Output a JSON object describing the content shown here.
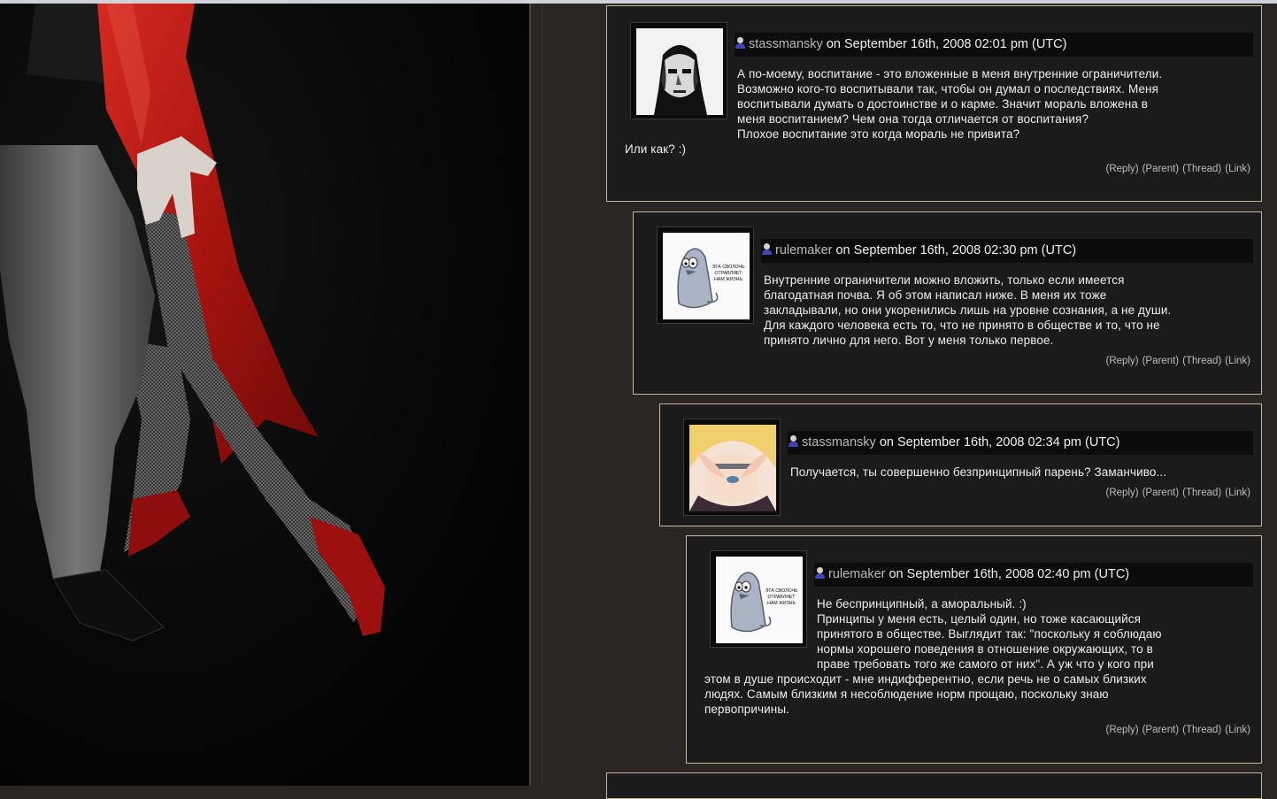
{
  "comments": [
    {
      "username": "stassmansky",
      "meta": " on September 16th, 2008 02:01 pm (UTC)",
      "avatar": "house-portrait",
      "lines_beside": [
        "А по-моему, воспитание - это вложенные в меня внутренние ограничители.",
        "Возможно кого-то воспитывали так, чтобы он думал о последствиях. Меня",
        "воспитывали думать о достоинстве и о карме. Значит мораль вложена в",
        "меня воспитанием? Чем она тогда отличается от воспитания?",
        "Плохое воспитание это когда мораль не привита?"
      ],
      "lines_below": [
        "Или как? :)"
      ],
      "links": [
        "(Reply)",
        "(Parent)",
        "(Thread)",
        "(Link)"
      ]
    },
    {
      "username": "rulemaker",
      "meta": " on September 16th, 2008 02:30 pm (UTC)",
      "avatar": "penguin-cartoon",
      "avatar_caption": [
        "ЭТА СВОЛОЧЬ",
        "ОТРАВЛЯЕТ",
        "НАМ ЖИЗНЬ"
      ],
      "lines_beside": [
        "Внутренние ограничители можно вложить, только если имеется",
        "благодатная почва. Я об этом написал ниже. В меня их тоже",
        "закладывали, но они укоренились лишь на уровне сознания, а не души.",
        "Для каждого человека есть то, что не принято в обществе и то, что не",
        "принято лично для него. Вот у меня только первое."
      ],
      "lines_below": [],
      "links": [
        "(Reply)",
        "(Parent)",
        "(Thread)",
        "(Link)"
      ]
    },
    {
      "username": "stassmansky",
      "meta": " on September 16th, 2008 02:34 pm (UTC)",
      "avatar": "anime-heart-hands",
      "lines_beside": [
        "Получается, ты совершенно безпринципный парень? Заманчиво..."
      ],
      "lines_below": [],
      "links": [
        "(Reply)",
        "(Parent)",
        "(Thread)",
        "(Link)"
      ]
    },
    {
      "username": "rulemaker",
      "meta": " on September 16th, 2008 02:40 pm (UTC)",
      "avatar": "penguin-cartoon",
      "avatar_caption": [
        "ЭТА СВОЛОЧЬ",
        "ОТРАВЛЯЕТ",
        "НАМ ЖИЗНЬ"
      ],
      "lines_beside": [
        "Не беспринципный, а аморальный. :)",
        "Принципы у меня есть, целый один, но тоже касающийся",
        "принятого в обществе. Выглядит так: \"поскольку я соблюдаю",
        "нормы хорошего поведения в отношение окружающих, то в",
        "праве требовать того же самого от них\". А уж что у кого при"
      ],
      "lines_below": [
        "этом в душе происходит - мне индифферентно, если речь не о самых близких",
        "людях. Самым близким я несоблюдение норм прощаю, поскольку знаю",
        "первопричины."
      ],
      "links": [
        "(Reply)",
        "(Parent)",
        "(Thread)",
        "(Link)"
      ]
    }
  ],
  "colors": {
    "page_bg": "#2a2623",
    "comment_bg": "#1b1b1b",
    "comment_border": "#c9b79a",
    "header_bg": "#0c0c0c",
    "dress_red": "#b01818"
  },
  "background_photo": "tango-dancers-red-dress"
}
